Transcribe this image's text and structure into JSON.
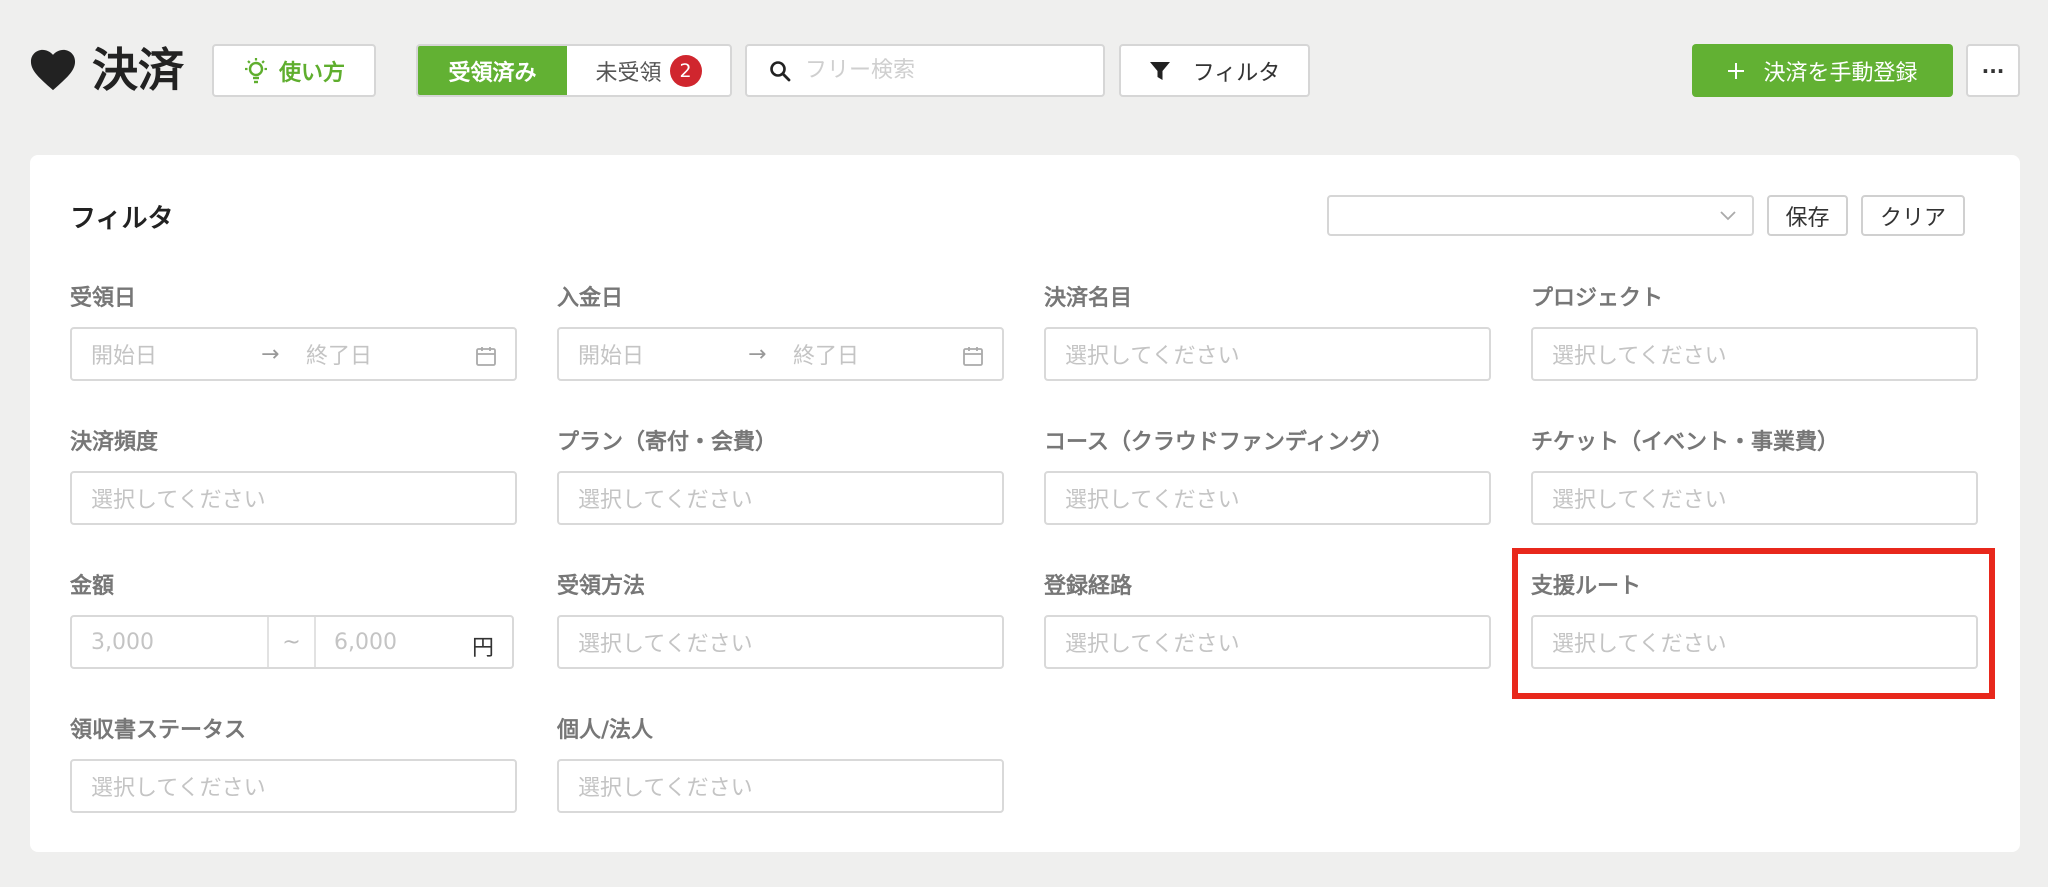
{
  "header": {
    "title": "決済",
    "howto_label": "使い方",
    "tabs": [
      {
        "label": "受領済み",
        "active": true
      },
      {
        "label": "未受領",
        "badge": "2",
        "active": false
      }
    ],
    "search_placeholder": "フリー検索",
    "filter_label": "フィルタ",
    "add_label": "決済を手動登録",
    "more_label": "···"
  },
  "panel": {
    "title": "フィルタ",
    "preset_value": "",
    "save_label": "保存",
    "clear_label": "クリア"
  },
  "fields": {
    "received_date": {
      "label": "受領日",
      "start": "開始日",
      "arrow": "→",
      "end": "終了日"
    },
    "deposit_date": {
      "label": "入金日",
      "start": "開始日",
      "arrow": "→",
      "end": "終了日"
    },
    "payment_item": {
      "label": "決済名目",
      "placeholder": "選択してください"
    },
    "project": {
      "label": "プロジェクト",
      "placeholder": "選択してください"
    },
    "frequency": {
      "label": "決済頻度",
      "placeholder": "選択してください"
    },
    "plan": {
      "label": "プラン（寄付・会費）",
      "placeholder": "選択してください"
    },
    "course": {
      "label": "コース（クラウドファンディング）",
      "placeholder": "選択してください"
    },
    "ticket": {
      "label": "チケット（イベント・事業費）",
      "placeholder": "選択してください"
    },
    "amount": {
      "label": "金額",
      "min": "3,000",
      "sep": "~",
      "max": "6,000",
      "unit": "円"
    },
    "method": {
      "label": "受領方法",
      "placeholder": "選択してください"
    },
    "route_reg": {
      "label": "登録経路",
      "placeholder": "選択してください"
    },
    "support_route": {
      "label": "支援ルート",
      "placeholder": "選択してください"
    },
    "receipt_status": {
      "label": "領収書ステータス",
      "placeholder": "選択してください"
    },
    "entity": {
      "label": "個人/法人",
      "placeholder": "選択してください"
    }
  },
  "colors": {
    "accent_green": "#62b133",
    "badge_red": "#d0262e",
    "highlight_red": "#e8281c",
    "background": "#efefee"
  },
  "icons": [
    "heart-icon",
    "lightbulb-icon",
    "search-icon",
    "funnel-icon",
    "plus-icon",
    "chevron-down-icon",
    "calendar-icon"
  ]
}
